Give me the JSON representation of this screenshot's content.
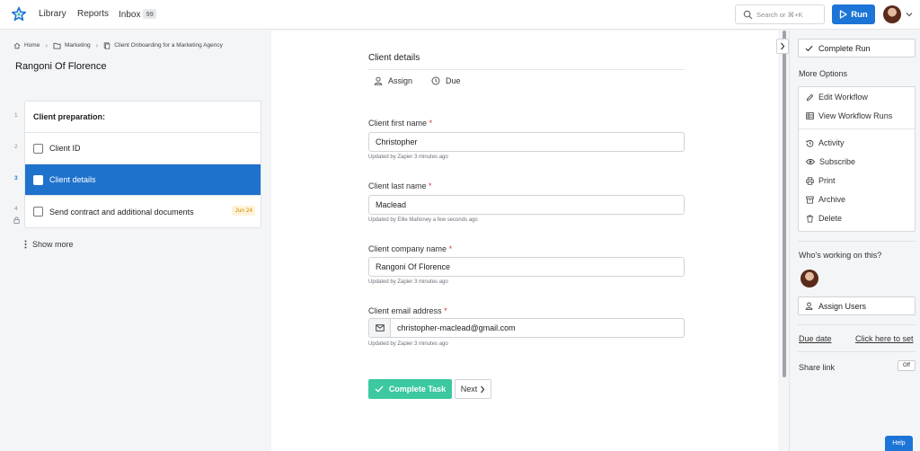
{
  "topbar": {
    "logo": "star-logo",
    "nav": [
      {
        "label": "Library"
      },
      {
        "label": "Reports"
      },
      {
        "label": "Inbox",
        "badge": "99"
      }
    ],
    "search_placeholder": "Search or ⌘+K",
    "run_label": "Run"
  },
  "breadcrumb": [
    "Home",
    "Marketing",
    "Client Onboarding for a Marketing Agency"
  ],
  "run_title": "Rangoni Of Florence",
  "tasks": [
    {
      "num": "1",
      "label": "Client preparation:",
      "type": "header"
    },
    {
      "num": "2",
      "label": "Client ID"
    },
    {
      "num": "3",
      "label": "Client details",
      "active": true
    },
    {
      "num": "4",
      "label": "Send contract and additional documents",
      "due": "Jun 24"
    }
  ],
  "show_more": "Show more",
  "main": {
    "section_title": "Client details",
    "actions": {
      "assign": "Assign",
      "due": "Due"
    },
    "fields": [
      {
        "label": "Client first name",
        "required": "*",
        "value": "Christopher",
        "meta": "Updated by Zapier 3 minutes ago"
      },
      {
        "label": "Client last name",
        "required": "*",
        "value": "Maclead",
        "meta": "Updated by Ellie Mahoney a few seconds ago"
      },
      {
        "label": "Client company name",
        "required": "*",
        "value": "Rangoni Of Florence",
        "meta": "Updated by Zapier 3 minutes ago"
      },
      {
        "label": "Client email address",
        "required": "*",
        "value": "christopher-maclead@gmail.com",
        "meta": "Updated by Zapier 3 minutes ago"
      }
    ],
    "complete_task": "Complete Task",
    "next": "Next"
  },
  "right": {
    "complete_run": "Complete Run",
    "more_options": "More Options",
    "menu": {
      "edit_workflow": "Edit Workflow",
      "view_runs": "View Workflow Runs",
      "activity": "Activity",
      "subscribe": "Subscribe",
      "print": "Print",
      "archive": "Archive",
      "delete": "Delete"
    },
    "who_working": "Who's working on this?",
    "assign_users": "Assign Users",
    "due_date": "Due date",
    "due_link": "Click here to set",
    "share_link": "Share link",
    "share_toggle": "Off"
  },
  "help": "Help",
  "colors": {
    "accent": "#1c74d6",
    "success": "#3cc8a0",
    "active_task": "#1f72cc",
    "required": "#d23b3b",
    "due_badge": "#d08a00"
  }
}
